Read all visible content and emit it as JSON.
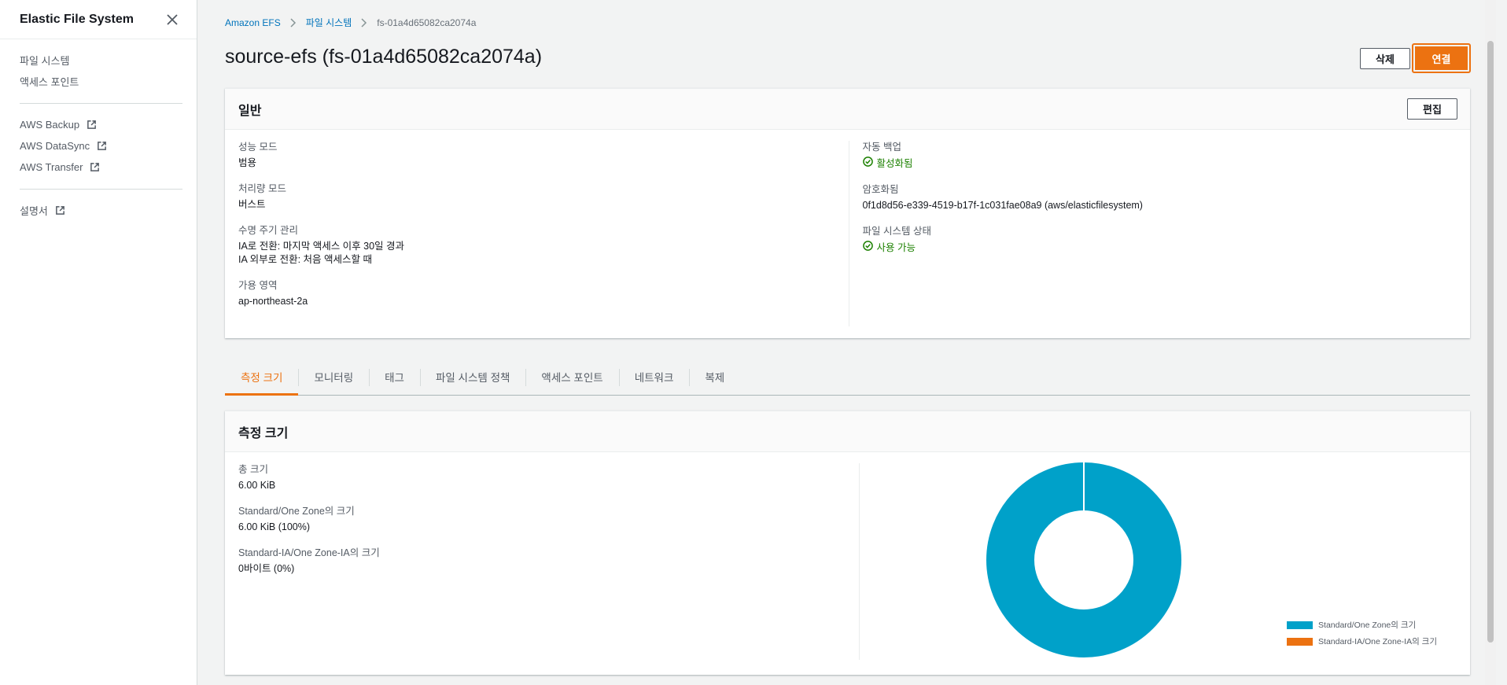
{
  "sidebar": {
    "title": "Elastic File System",
    "items_primary": [
      "파일 시스템",
      "액세스 포인트"
    ],
    "items_services": [
      "AWS Backup",
      "AWS DataSync",
      "AWS Transfer"
    ],
    "items_docs": [
      "설명서"
    ]
  },
  "breadcrumb": {
    "root": "Amazon EFS",
    "section": "파일 시스템",
    "current": "fs-01a4d65082ca2074a"
  },
  "page": {
    "title": "source-efs (fs-01a4d65082ca2074a)",
    "delete_label": "삭제",
    "connect_label": "연결"
  },
  "general": {
    "heading": "일반",
    "edit_label": "편집",
    "performance_mode": {
      "label": "성능 모드",
      "value": "범용"
    },
    "throughput_mode": {
      "label": "처리량 모드",
      "value": "버스트"
    },
    "lifecycle": {
      "label": "수명 주기 관리",
      "line1": "IA로 전환: 마지막 액세스 이후 30일 경과",
      "line2": "IA 외부로 전환: 처음 액세스할 때"
    },
    "availability_zone": {
      "label": "가용 영역",
      "value": "ap-northeast-2a"
    },
    "auto_backup": {
      "label": "자동 백업",
      "value": "활성화됨"
    },
    "encryption": {
      "label": "암호화됨",
      "value": "0f1d8d56-e339-4519-b17f-1c031fae08a9 (aws/elasticfilesystem)"
    },
    "fs_state": {
      "label": "파일 시스템 상태",
      "value": "사용 가능"
    }
  },
  "tabs": [
    "측정 크기",
    "모니터링",
    "태그",
    "파일 시스템 정책",
    "액세스 포인트",
    "네트워크",
    "복제"
  ],
  "metered_size": {
    "heading": "측정 크기",
    "total": {
      "label": "총 크기",
      "value": "6.00 KiB"
    },
    "standard": {
      "label": "Standard/One Zone의 크기",
      "value": "6.00 KiB (100%)"
    },
    "ia": {
      "label": "Standard-IA/One Zone-IA의 크기",
      "value": "0바이트 (0%)"
    }
  },
  "chart_data": {
    "type": "pie",
    "categories": [
      "Standard/One Zone의 크기",
      "Standard-IA/One Zone-IA의 크기"
    ],
    "values": [
      100,
      0
    ],
    "colors": [
      "#00a1c9",
      "#ec7211"
    ],
    "legend": "bottom-right"
  },
  "colors": {
    "accent": "#ec7211",
    "link": "#0073bb",
    "success": "#1d8102"
  }
}
